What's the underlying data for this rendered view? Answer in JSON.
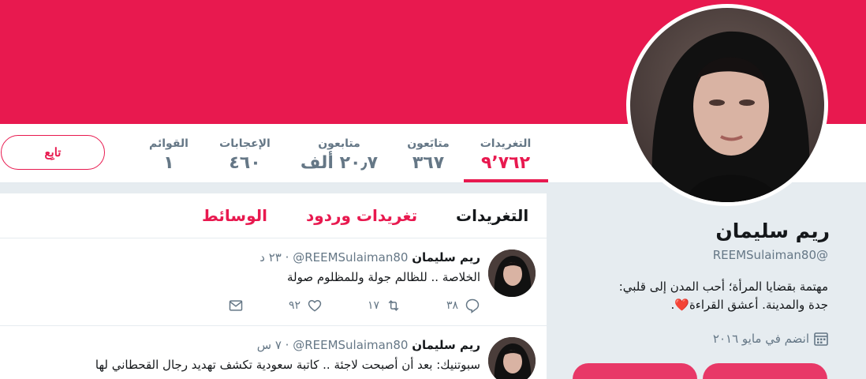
{
  "colors": {
    "accent": "#e8194f",
    "muted": "#657786",
    "text": "#14171a"
  },
  "profile": {
    "name": "ريم سليمان",
    "handle": "@REEMSulaiman80",
    "bio_line1": "مهتمة بقضايا المرأة؛ أحب المدن إلى قلبي:",
    "bio_line2": "جدة والمدينة. أعشق القراءة",
    "bio_heart": "❤️",
    "bio_end": ".",
    "joined": "انضم في مايو ٢٠١٦"
  },
  "nav": {
    "follow_label": "تابِع",
    "stats": [
      {
        "label": "التغريدات",
        "value": "٩٬٧٦٢"
      },
      {
        "label": "متابَعون",
        "value": "٣٦٧"
      },
      {
        "label": "متابعون",
        "value": "٢٠٫٧ ألف"
      },
      {
        "label": "الإعجابات",
        "value": "٤٦٠"
      },
      {
        "label": "القوائم",
        "value": "١"
      }
    ]
  },
  "tabs": [
    {
      "label": "التغريدات"
    },
    {
      "label": "تغريدات وردود"
    },
    {
      "label": "الوسائط"
    }
  ],
  "tweets": [
    {
      "name": "ريم سليمان",
      "handle": "@REEMSulaiman80",
      "dot": " · ",
      "time": "٢٣ د",
      "text": "الخلاصة .. للظالم جولة وللمظلوم صولة",
      "replies": "٣٨",
      "retweets": "١٧",
      "likes": "٩٢"
    },
    {
      "name": "ريم سليمان",
      "handle": "@REEMSulaiman80",
      "dot": " · ",
      "time": "٧ س",
      "text": "سبوتنيك: بعد أن أصبحت لاجئة .. كاتبة سعودية تكشف تهديد رجال القحطاني لها"
    }
  ]
}
